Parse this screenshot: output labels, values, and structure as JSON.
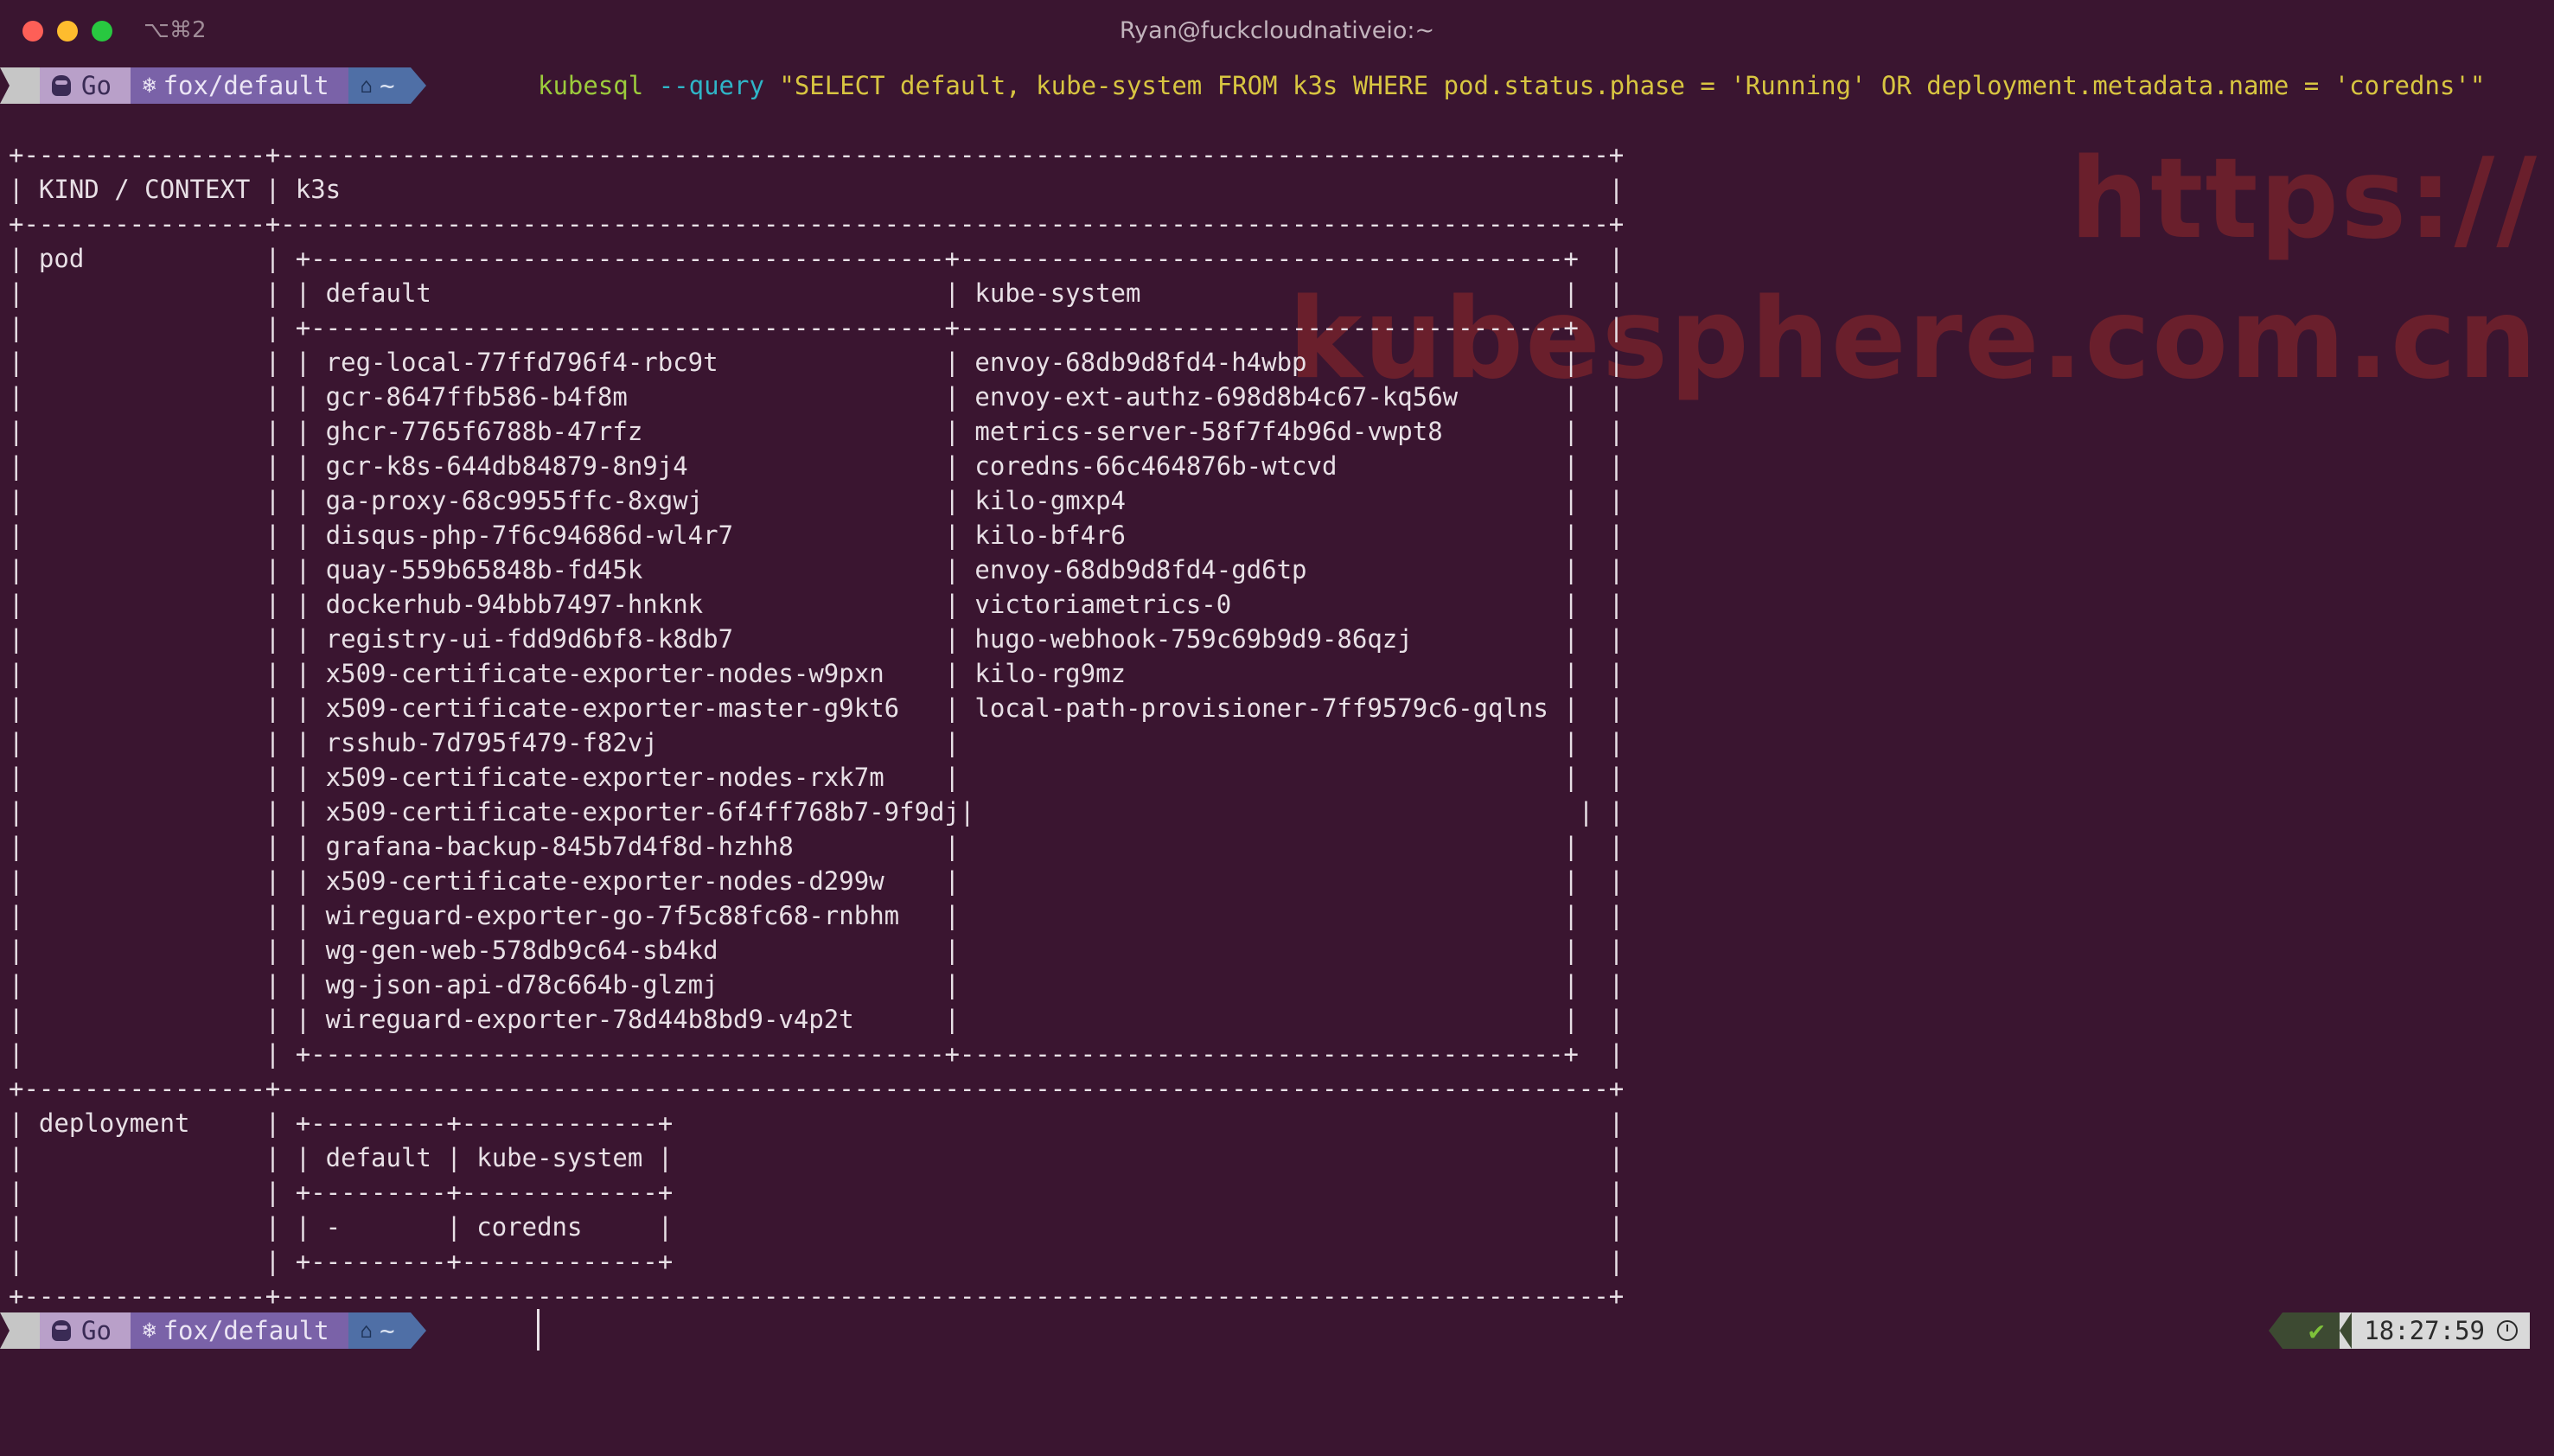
{
  "window": {
    "title": "Ryan@fuckcloudnativeio:~",
    "shortcut": "⌥⌘2"
  },
  "prompt": {
    "apple_icon": "apple-icon",
    "go_label": "Go",
    "k8s_context": "fox/default",
    "home_dir": "~"
  },
  "command": {
    "program": "kubesql",
    "flag": "--query",
    "query": "\"SELECT default, kube-system FROM k3s WHERE pod.status.phase = 'Running' OR deployment.metadata.name = 'coredns'\""
  },
  "table": {
    "header": {
      "kind_context": "KIND / CONTEXT",
      "cluster": "k3s"
    },
    "pod": {
      "kind": "pod",
      "columns": [
        "default",
        "kube-system"
      ],
      "default_pods": [
        "reg-local-77ffd796f4-rbc9t",
        "gcr-8647ffb586-b4f8m",
        "ghcr-7765f6788b-47rfz",
        "gcr-k8s-644db84879-8n9j4",
        "ga-proxy-68c9955ffc-8xgwj",
        "disqus-php-7f6c94686d-wl4r7",
        "quay-559b65848b-fd45k",
        "dockerhub-94bbb7497-hnknk",
        "registry-ui-fdd9d6bf8-k8db7",
        "x509-certificate-exporter-nodes-w9pxn",
        "x509-certificate-exporter-master-g9kt6",
        "rsshub-7d795f479-f82vj",
        "x509-certificate-exporter-nodes-rxk7m",
        "x509-certificate-exporter-6f4ff768b7-9f9dj",
        "grafana-backup-845b7d4f8d-hzhh8",
        "x509-certificate-exporter-nodes-d299w",
        "wireguard-exporter-go-7f5c88fc68-rnbhm",
        "wg-gen-web-578db9c64-sb4kd",
        "wg-json-api-d78c664b-glzmj",
        "wireguard-exporter-78d44b8bd9-v4p2t"
      ],
      "kube_system_pods": [
        "envoy-68db9d8fd4-h4wbp",
        "envoy-ext-authz-698d8b4c67-kq56w",
        "metrics-server-58f7f4b96d-vwpt8",
        "coredns-66c464876b-wtcvd",
        "kilo-gmxp4",
        "kilo-bf4r6",
        "envoy-68db9d8fd4-gd6tp",
        "victoriametrics-0",
        "hugo-webhook-759c69b9d9-86qzj",
        "kilo-rg9mz",
        "local-path-provisioner-7ff9579c6-gqlns"
      ]
    },
    "deployment": {
      "kind": "deployment",
      "columns": [
        "default",
        "kube-system"
      ],
      "row": [
        "-",
        "coredns"
      ]
    }
  },
  "watermark": {
    "line1": "https://",
    "line2": "kubesphere.com.cn"
  },
  "status": {
    "check_icon": "check-icon",
    "time": "18:27:59",
    "clock_icon": "clock-icon"
  },
  "colors": {
    "background": "#3a1530",
    "command_program": "#9ccb3c",
    "command_flag": "#2fb5c7",
    "command_string": "#d8c541",
    "watermark": "#6a1f2c"
  }
}
